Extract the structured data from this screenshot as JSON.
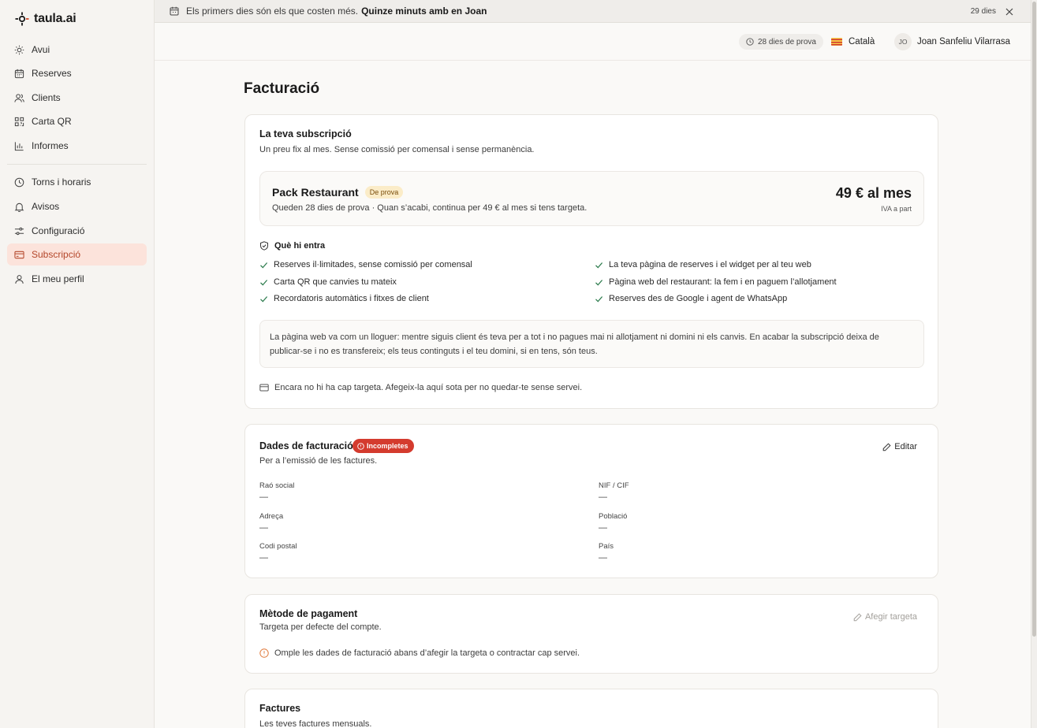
{
  "app": {
    "logo_text": "taula",
    "logo_suffix": ".ai"
  },
  "sidebar": {
    "items": [
      {
        "label": "Avui",
        "icon": "sun-icon"
      },
      {
        "label": "Reserves",
        "icon": "calendar-icon"
      },
      {
        "label": "Clients",
        "icon": "users-icon"
      },
      {
        "label": "Carta QR",
        "icon": "qr-icon"
      },
      {
        "label": "Informes",
        "icon": "bar-chart-icon"
      },
      {
        "label": "Torns i horaris",
        "icon": "clock-icon"
      },
      {
        "label": "Avisos",
        "icon": "bell-icon"
      },
      {
        "label": "Configuració",
        "icon": "sliders-icon"
      },
      {
        "label": "Subscripció",
        "icon": "credit-card-icon",
        "active": true
      },
      {
        "label": "El meu perfil",
        "icon": "user-icon"
      }
    ]
  },
  "banner": {
    "text": "Els primers dies són els que costen més.",
    "link": "Quinze minuts amb en Joan",
    "days": "29 dies"
  },
  "header": {
    "trial": "28 dies de prova",
    "language": "Català",
    "user_initials": "JO",
    "user_name": "Joan Sanfeliu Vilarrasa"
  },
  "page": {
    "title": "Facturació"
  },
  "subscription": {
    "title": "La teva subscripció",
    "subtitle": "Un preu fix al mes. Sense comissió per comensal i sense permanència.",
    "plan_name": "Pack Restaurant",
    "plan_badge": "De prova",
    "plan_desc": "Queden 28 dies de prova · Quan s’acabi, continua per 49 € al mes si tens targeta.",
    "price": "49 € al mes",
    "vat": "IVA a part",
    "includes_title": "Què hi entra",
    "features_left": [
      "Reserves il·limitades, sense comissió per comensal",
      "Carta QR que canvies tu mateix",
      "Recordatoris automàtics i fitxes de client"
    ],
    "features_right": [
      "La teva pàgina de reserves i el widget per al teu web",
      "Pàgina web del restaurant: la fem i en paguem l’allotjament",
      "Reserves des de Google i agent de WhatsApp"
    ],
    "note": "La pàgina web va com un lloguer: mentre siguis client és teva per a tot i no pagues mai ni allotjament ni domini ni els canvis. En acabar la subscripció deixa de publicar-se i no es transfereix; els teus continguts i el teu domini, si en tens, són teus.",
    "no_card": "Encara no hi ha cap targeta. Afegeix-la aquí sota per no quedar-te sense servei."
  },
  "billing": {
    "title": "Dades de facturació",
    "badge": "Incompletes",
    "subtitle": "Per a l’emissió de les factures.",
    "edit": "Editar",
    "fields": [
      {
        "label": "Raó social",
        "value": "—"
      },
      {
        "label": "NIF / CIF",
        "value": "—"
      },
      {
        "label": "Adreça",
        "value": "—"
      },
      {
        "label": "Població",
        "value": "—"
      },
      {
        "label": "Codi postal",
        "value": "—"
      },
      {
        "label": "País",
        "value": "—"
      }
    ]
  },
  "payment": {
    "title": "Mètode de pagament",
    "subtitle": "Targeta per defecte del compte.",
    "add_card": "Afegir targeta",
    "warning": "Omple les dades de facturació abans d’afegir la targeta o contractar cap servei."
  },
  "invoices": {
    "title": "Factures",
    "subtitle": "Les teves factures mensuals."
  },
  "colors": {
    "accent": "#b4472a",
    "active_bg": "#fce3db",
    "danger": "#d43b2e",
    "warning": "#e07a3c"
  }
}
